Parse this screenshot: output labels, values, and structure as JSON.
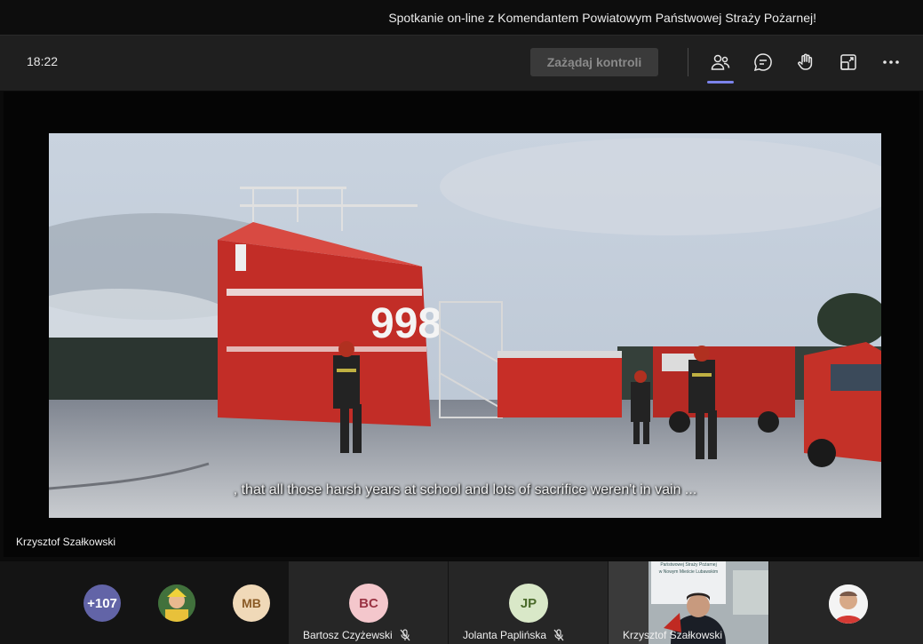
{
  "window": {
    "title": "Spotkanie on-line z Komendantem Powiatowym Państwowej Straży Pożarnej!"
  },
  "toolbar": {
    "clock": "18:22",
    "request_control_label": "Zażądaj kontroli",
    "icons": [
      "participants-icon",
      "chat-icon",
      "raise-hand-icon",
      "share-tray-icon",
      "more-options-icon"
    ]
  },
  "stage": {
    "video_caption": ", that all those harsh years at school and lots of sacrifice weren't in vain ...",
    "building_number": "998",
    "presenter_name": "Krzysztof Szałkowski"
  },
  "participants": {
    "overflow_count": "+107",
    "mb_initials": "MB",
    "bc": {
      "initials": "BC",
      "name": "Bartosz Czyżewski"
    },
    "jp": {
      "initials": "JP",
      "name": "Jolanta Paplińska"
    },
    "ks": {
      "name": "Krzysztof Szałkowski",
      "sign_text": [
        "Państwowej Straży Pożarnej",
        "w Nowym Mieście Lubawskim"
      ]
    }
  },
  "colors": {
    "accent": "#7b83eb",
    "overflow_badge": "#6264a7",
    "mb_avatar": "#f0d9b8",
    "bc_avatar": "#f4c7cc",
    "jp_avatar": "#d9e8c8"
  }
}
